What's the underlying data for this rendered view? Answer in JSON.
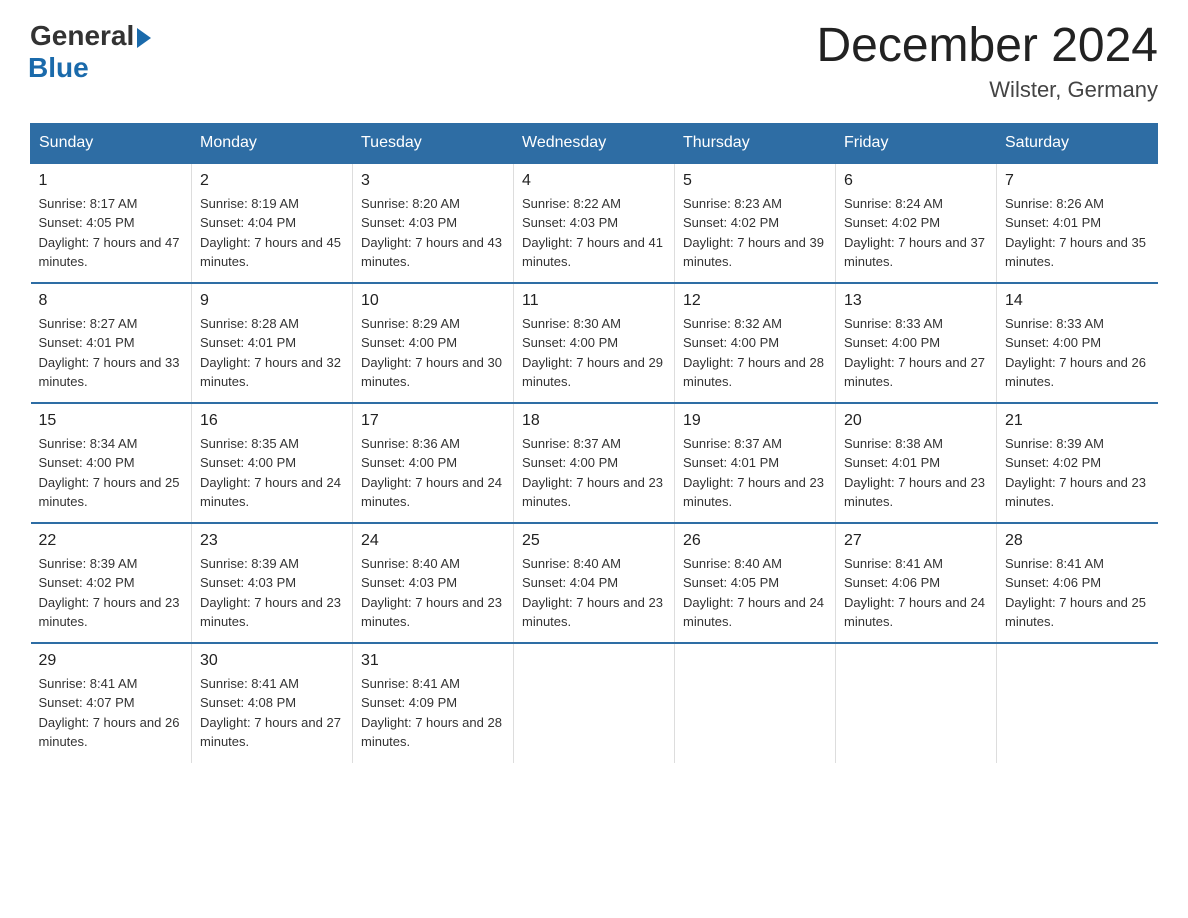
{
  "logo": {
    "general": "General",
    "blue": "Blue"
  },
  "title": "December 2024",
  "location": "Wilster, Germany",
  "days_of_week": [
    "Sunday",
    "Monday",
    "Tuesday",
    "Wednesday",
    "Thursday",
    "Friday",
    "Saturday"
  ],
  "weeks": [
    [
      {
        "day": "1",
        "sunrise": "8:17 AM",
        "sunset": "4:05 PM",
        "daylight": "7 hours and 47 minutes."
      },
      {
        "day": "2",
        "sunrise": "8:19 AM",
        "sunset": "4:04 PM",
        "daylight": "7 hours and 45 minutes."
      },
      {
        "day": "3",
        "sunrise": "8:20 AM",
        "sunset": "4:03 PM",
        "daylight": "7 hours and 43 minutes."
      },
      {
        "day": "4",
        "sunrise": "8:22 AM",
        "sunset": "4:03 PM",
        "daylight": "7 hours and 41 minutes."
      },
      {
        "day": "5",
        "sunrise": "8:23 AM",
        "sunset": "4:02 PM",
        "daylight": "7 hours and 39 minutes."
      },
      {
        "day": "6",
        "sunrise": "8:24 AM",
        "sunset": "4:02 PM",
        "daylight": "7 hours and 37 minutes."
      },
      {
        "day": "7",
        "sunrise": "8:26 AM",
        "sunset": "4:01 PM",
        "daylight": "7 hours and 35 minutes."
      }
    ],
    [
      {
        "day": "8",
        "sunrise": "8:27 AM",
        "sunset": "4:01 PM",
        "daylight": "7 hours and 33 minutes."
      },
      {
        "day": "9",
        "sunrise": "8:28 AM",
        "sunset": "4:01 PM",
        "daylight": "7 hours and 32 minutes."
      },
      {
        "day": "10",
        "sunrise": "8:29 AM",
        "sunset": "4:00 PM",
        "daylight": "7 hours and 30 minutes."
      },
      {
        "day": "11",
        "sunrise": "8:30 AM",
        "sunset": "4:00 PM",
        "daylight": "7 hours and 29 minutes."
      },
      {
        "day": "12",
        "sunrise": "8:32 AM",
        "sunset": "4:00 PM",
        "daylight": "7 hours and 28 minutes."
      },
      {
        "day": "13",
        "sunrise": "8:33 AM",
        "sunset": "4:00 PM",
        "daylight": "7 hours and 27 minutes."
      },
      {
        "day": "14",
        "sunrise": "8:33 AM",
        "sunset": "4:00 PM",
        "daylight": "7 hours and 26 minutes."
      }
    ],
    [
      {
        "day": "15",
        "sunrise": "8:34 AM",
        "sunset": "4:00 PM",
        "daylight": "7 hours and 25 minutes."
      },
      {
        "day": "16",
        "sunrise": "8:35 AM",
        "sunset": "4:00 PM",
        "daylight": "7 hours and 24 minutes."
      },
      {
        "day": "17",
        "sunrise": "8:36 AM",
        "sunset": "4:00 PM",
        "daylight": "7 hours and 24 minutes."
      },
      {
        "day": "18",
        "sunrise": "8:37 AM",
        "sunset": "4:00 PM",
        "daylight": "7 hours and 23 minutes."
      },
      {
        "day": "19",
        "sunrise": "8:37 AM",
        "sunset": "4:01 PM",
        "daylight": "7 hours and 23 minutes."
      },
      {
        "day": "20",
        "sunrise": "8:38 AM",
        "sunset": "4:01 PM",
        "daylight": "7 hours and 23 minutes."
      },
      {
        "day": "21",
        "sunrise": "8:39 AM",
        "sunset": "4:02 PM",
        "daylight": "7 hours and 23 minutes."
      }
    ],
    [
      {
        "day": "22",
        "sunrise": "8:39 AM",
        "sunset": "4:02 PM",
        "daylight": "7 hours and 23 minutes."
      },
      {
        "day": "23",
        "sunrise": "8:39 AM",
        "sunset": "4:03 PM",
        "daylight": "7 hours and 23 minutes."
      },
      {
        "day": "24",
        "sunrise": "8:40 AM",
        "sunset": "4:03 PM",
        "daylight": "7 hours and 23 minutes."
      },
      {
        "day": "25",
        "sunrise": "8:40 AM",
        "sunset": "4:04 PM",
        "daylight": "7 hours and 23 minutes."
      },
      {
        "day": "26",
        "sunrise": "8:40 AM",
        "sunset": "4:05 PM",
        "daylight": "7 hours and 24 minutes."
      },
      {
        "day": "27",
        "sunrise": "8:41 AM",
        "sunset": "4:06 PM",
        "daylight": "7 hours and 24 minutes."
      },
      {
        "day": "28",
        "sunrise": "8:41 AM",
        "sunset": "4:06 PM",
        "daylight": "7 hours and 25 minutes."
      }
    ],
    [
      {
        "day": "29",
        "sunrise": "8:41 AM",
        "sunset": "4:07 PM",
        "daylight": "7 hours and 26 minutes."
      },
      {
        "day": "30",
        "sunrise": "8:41 AM",
        "sunset": "4:08 PM",
        "daylight": "7 hours and 27 minutes."
      },
      {
        "day": "31",
        "sunrise": "8:41 AM",
        "sunset": "4:09 PM",
        "daylight": "7 hours and 28 minutes."
      },
      null,
      null,
      null,
      null
    ]
  ]
}
